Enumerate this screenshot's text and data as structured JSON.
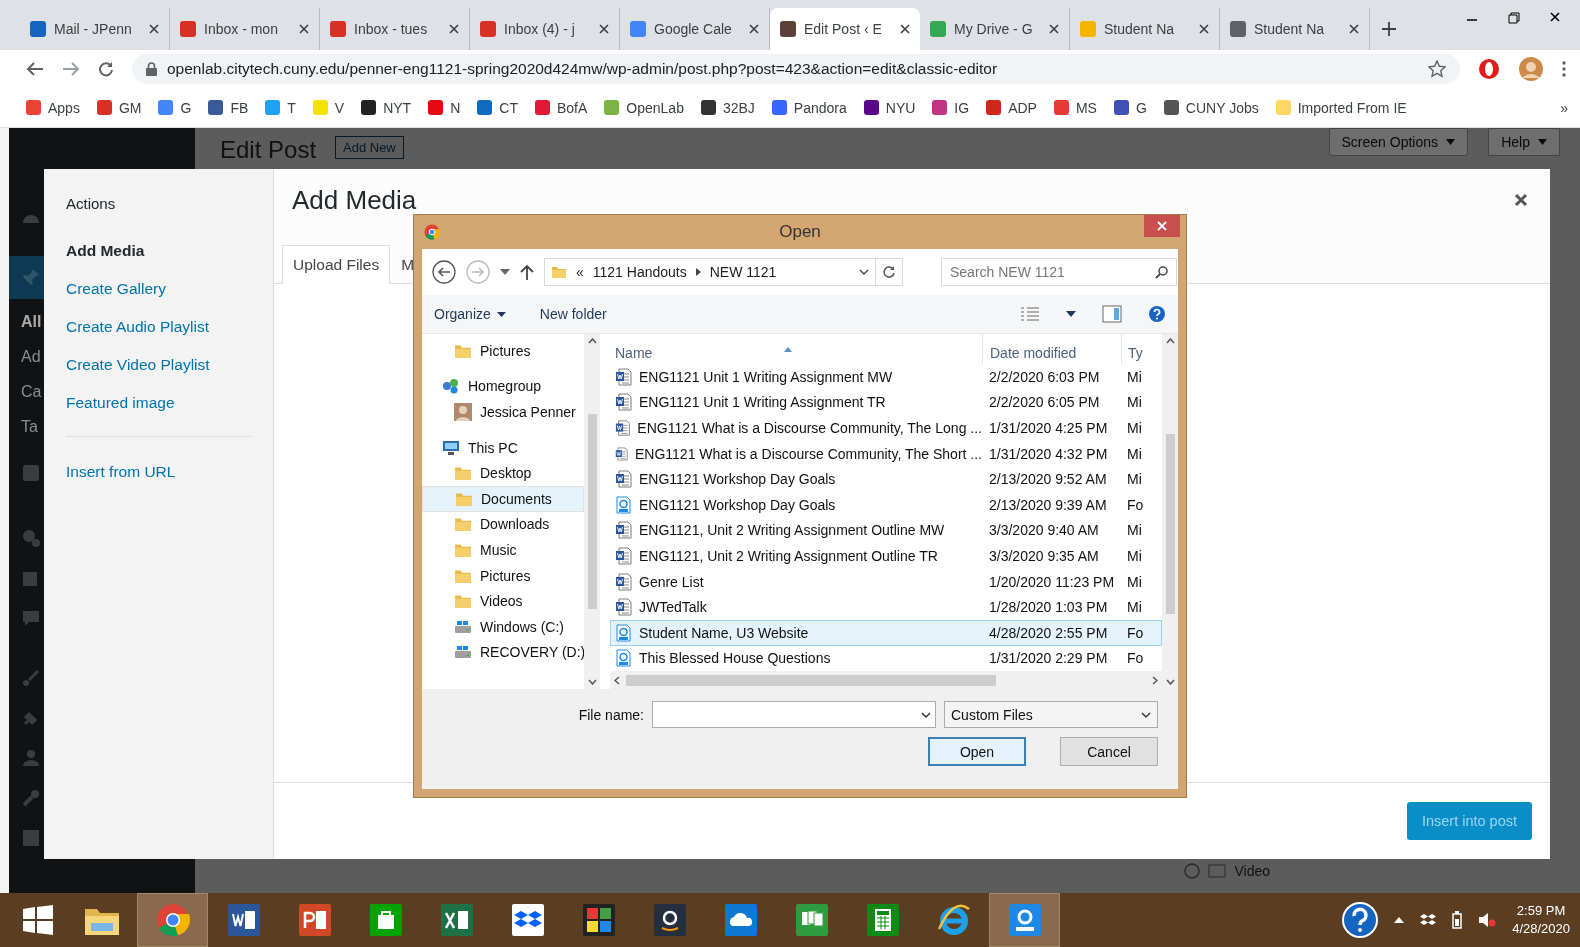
{
  "browser": {
    "tabs": [
      {
        "title": "Mail - JPenn",
        "color": "#1565c0",
        "selected": false
      },
      {
        "title": "Inbox - mon",
        "color": "#d93025",
        "selected": false
      },
      {
        "title": "Inbox - tues",
        "color": "#d93025",
        "selected": false
      },
      {
        "title": "Inbox (4) - j",
        "color": "#d93025",
        "selected": false
      },
      {
        "title": "Google Cale",
        "color": "#4285f4",
        "selected": false
      },
      {
        "title": "Edit Post ‹ E",
        "color": "#5d4037",
        "selected": true
      },
      {
        "title": "My Drive - G",
        "color": "#34a853",
        "selected": false
      },
      {
        "title": "Student Na",
        "color": "#f4b400",
        "selected": false
      },
      {
        "title": "Student Na",
        "color": "#5f6368",
        "selected": false
      }
    ],
    "url": "openlab.citytech.cuny.edu/penner-eng1121-spring2020d424mw/wp-admin/post.php?post=423&action=edit&classic-editor",
    "bookmarks": [
      {
        "label": "Apps",
        "color": "#ea4335"
      },
      {
        "label": "GM",
        "color": "#d93025"
      },
      {
        "label": "G",
        "color": "#4285f4"
      },
      {
        "label": "FB",
        "color": "#3b5998"
      },
      {
        "label": "T",
        "color": "#1da1f2"
      },
      {
        "label": "V",
        "color": "#f4e300"
      },
      {
        "label": "NYT",
        "color": "#222222"
      },
      {
        "label": "N",
        "color": "#e50914"
      },
      {
        "label": "CT",
        "color": "#0f6cbd"
      },
      {
        "label": "BofA",
        "color": "#e31837"
      },
      {
        "label": "OpenLab",
        "color": "#7cb342"
      },
      {
        "label": "32BJ",
        "color": "#333333"
      },
      {
        "label": "Pandora",
        "color": "#3668ff"
      },
      {
        "label": "NYU",
        "color": "#57068c"
      },
      {
        "label": "IG",
        "color": "#c13584"
      },
      {
        "label": "ADP",
        "color": "#d0271d"
      },
      {
        "label": "MS",
        "color": "#e53935"
      },
      {
        "label": "G",
        "color": "#3f51b5"
      },
      {
        "label": "CUNY Jobs",
        "color": "#555555"
      },
      {
        "label": "Imported From IE",
        "color": "#fdd663"
      }
    ],
    "more": "»"
  },
  "admin": {
    "page_title": "Edit Post",
    "add_new": "Add New",
    "screen_options": "Screen Options",
    "help": "Help",
    "menu_fragments": [
      "All",
      "Ad",
      "Ca",
      "Ta"
    ],
    "video_option": "Video"
  },
  "media_modal": {
    "actions_heading": "Actions",
    "menu": [
      {
        "label": "Add Media",
        "selected": true
      },
      {
        "label": "Create Gallery",
        "selected": false
      },
      {
        "label": "Create Audio Playlist",
        "selected": false
      },
      {
        "label": "Create Video Playlist",
        "selected": false
      },
      {
        "label": "Featured image",
        "selected": false
      }
    ],
    "insert_from_url": "Insert from URL",
    "title": "Add Media",
    "tabs": [
      {
        "label": "Upload Files",
        "selected": true
      },
      {
        "label": "M",
        "selected": false
      }
    ],
    "insert_button": "Insert into post"
  },
  "open_dialog": {
    "title": "Open",
    "path": [
      {
        "label": "1121 Handouts"
      },
      {
        "label": "NEW 1121"
      }
    ],
    "path_prefix": "«",
    "search_placeholder": "Search NEW 1121",
    "organize": "Organize",
    "new_folder": "New folder",
    "nav": [
      {
        "children": [
          {
            "label": "Pictures",
            "kind": "folder",
            "selected": false
          }
        ]
      },
      {
        "label": "Homegroup",
        "kind": "homegroup",
        "selected": false,
        "children": [
          {
            "label": "Jessica Penner",
            "kind": "user",
            "selected": false
          }
        ]
      },
      {
        "label": "This PC",
        "kind": "pc",
        "selected": false,
        "children": [
          {
            "label": "Desktop",
            "kind": "folder",
            "selected": false
          },
          {
            "label": "Documents",
            "kind": "folder",
            "selected": true
          },
          {
            "label": "Downloads",
            "kind": "folder",
            "selected": false
          },
          {
            "label": "Music",
            "kind": "folder",
            "selected": false
          },
          {
            "label": "Pictures",
            "kind": "folder",
            "selected": false
          },
          {
            "label": "Videos",
            "kind": "folder",
            "selected": false
          },
          {
            "label": "Windows (C:)",
            "kind": "drive",
            "selected": false
          },
          {
            "label": "RECOVERY (D:)",
            "kind": "drive",
            "selected": false
          }
        ]
      }
    ],
    "columns": [
      "Name",
      "Date modified",
      "Ty"
    ],
    "files": [
      {
        "name": "ENG1121 Unit 1 Writing Assignment MW",
        "date": "2/2/2020 6:03 PM",
        "type": "Mi",
        "kind": "word",
        "selected": false
      },
      {
        "name": "ENG1121 Unit 1 Writing Assignment TR",
        "date": "2/2/2020 6:05 PM",
        "type": "Mi",
        "kind": "word",
        "selected": false
      },
      {
        "name": "ENG1121 What is a Discourse Community, The Long ...",
        "date": "1/31/2020 4:25 PM",
        "type": "Mi",
        "kind": "word",
        "selected": false
      },
      {
        "name": "ENG1121 What is a Discourse Community, The Short ...",
        "date": "1/31/2020 4:32 PM",
        "type": "Mi",
        "kind": "word",
        "selected": false
      },
      {
        "name": "ENG1121 Workshop Day Goals",
        "date": "2/13/2020 9:52 AM",
        "type": "Mi",
        "kind": "word",
        "selected": false
      },
      {
        "name": "ENG1121 Workshop Day Goals",
        "date": "2/13/2020 9:39 AM",
        "type": "Fo",
        "kind": "pdf",
        "selected": false
      },
      {
        "name": "ENG1121, Unit 2 Writing Assignment Outline MW",
        "date": "3/3/2020 9:40 AM",
        "type": "Mi",
        "kind": "word",
        "selected": false
      },
      {
        "name": "ENG1121, Unit 2 Writing Assignment Outline TR",
        "date": "3/3/2020 9:35 AM",
        "type": "Mi",
        "kind": "word",
        "selected": false
      },
      {
        "name": "Genre List",
        "date": "1/20/2020 11:23 PM",
        "type": "Mi",
        "kind": "word",
        "selected": false
      },
      {
        "name": "JWTedTalk",
        "date": "1/28/2020 1:03 PM",
        "type": "Mi",
        "kind": "word",
        "selected": false
      },
      {
        "name": "Student Name, U3 Website",
        "date": "4/28/2020 2:55 PM",
        "type": "Fo",
        "kind": "pdf",
        "selected": true
      },
      {
        "name": "This Blessed House Questions",
        "date": "1/31/2020 2:29 PM",
        "type": "Fo",
        "kind": "pdf",
        "selected": false
      }
    ],
    "file_name_label": "File name:",
    "file_type": "Custom Files",
    "open_button": "Open",
    "cancel_button": "Cancel"
  },
  "taskbar": {
    "apps": [
      {
        "kind": "explorer",
        "active": false
      },
      {
        "kind": "chrome",
        "active": true
      },
      {
        "kind": "word",
        "active": false
      },
      {
        "kind": "powerpoint",
        "active": false
      },
      {
        "kind": "store",
        "active": false
      },
      {
        "kind": "excel",
        "active": false
      },
      {
        "kind": "dropbox",
        "active": false
      },
      {
        "kind": "puzzle",
        "active": false
      },
      {
        "kind": "amazon",
        "active": false
      },
      {
        "kind": "cloud",
        "active": false
      },
      {
        "kind": "cards",
        "active": false
      },
      {
        "kind": "calculator",
        "active": false
      },
      {
        "kind": "ie",
        "active": false
      },
      {
        "kind": "pdf",
        "active": true
      }
    ],
    "time": "2:59 PM",
    "date": "4/28/2020"
  }
}
